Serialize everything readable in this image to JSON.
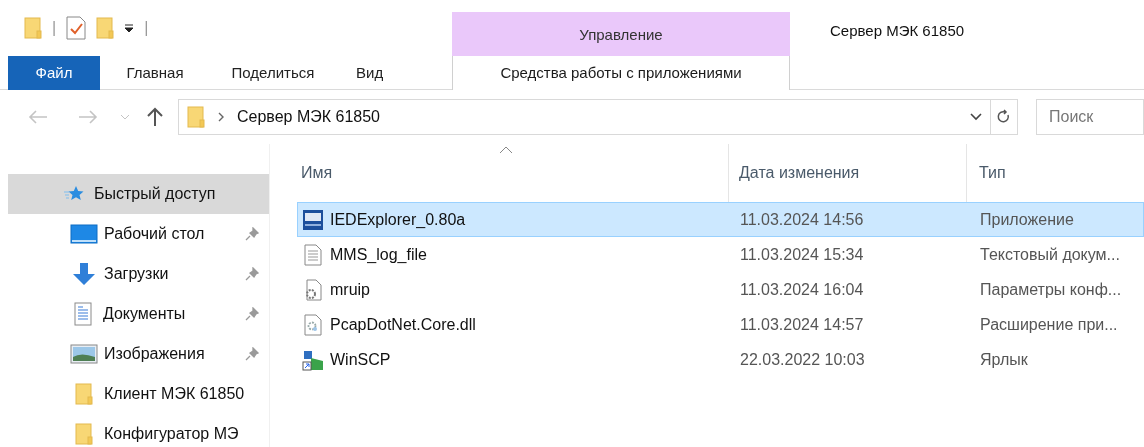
{
  "quick_access_toolbar": {
    "separator": "|"
  },
  "contextual_tab": {
    "group": "Управление",
    "tab": "Средства работы с приложениями",
    "selected": false
  },
  "window": {
    "title": "Сервер МЭК 61850"
  },
  "ribbon_tabs": [
    {
      "label": "Файл",
      "selected": true
    },
    {
      "label": "Главная",
      "selected": false
    },
    {
      "label": "Поделиться",
      "selected": false
    },
    {
      "label": "Вид",
      "selected": false
    }
  ],
  "address_bar": {
    "path": "Сервер МЭК 61850"
  },
  "search": {
    "placeholder": "Поиск"
  },
  "sidebar": {
    "items": [
      {
        "kind": "star",
        "label": "Быстрый доступ",
        "selected": true,
        "pinned": false,
        "children": [
          {
            "kind": "desktop",
            "label": "Рабочий стол",
            "selected": false,
            "pinned": true
          },
          {
            "kind": "downloads",
            "label": "Загрузки",
            "selected": false,
            "pinned": true
          },
          {
            "kind": "documents",
            "label": "Документы",
            "selected": false,
            "pinned": true
          },
          {
            "kind": "images",
            "label": "Изображения",
            "selected": false,
            "pinned": true
          },
          {
            "kind": "folder",
            "label": "Клиент МЭК 61850",
            "selected": false,
            "pinned": false
          },
          {
            "kind": "folder",
            "label": "Конфигуратор МЭ",
            "selected": false,
            "pinned": false
          }
        ]
      }
    ]
  },
  "table": {
    "columns": [
      "Имя",
      "Дата изменения",
      "Тип"
    ],
    "rows": [
      {
        "kind": "app",
        "name": "IEDExplorer_0.80a",
        "date": "11.03.2024 14:56",
        "type": "Приложение",
        "selected": true
      },
      {
        "kind": "text",
        "name": "MMS_log_file",
        "date": "11.03.2024 15:34",
        "type": "Текстовый докум...",
        "selected": false
      },
      {
        "kind": "config",
        "name": "mruip",
        "date": "11.03.2024 16:04",
        "type": "Параметры конф...",
        "selected": false
      },
      {
        "kind": "dll",
        "name": "PcapDotNet.Core.dll",
        "date": "11.03.2024 14:57",
        "type": "Расширение при...",
        "selected": false
      },
      {
        "kind": "shortcut",
        "name": "WinSCP",
        "date": "22.03.2022 10:03",
        "type": "Ярлык",
        "selected": false
      }
    ]
  }
}
